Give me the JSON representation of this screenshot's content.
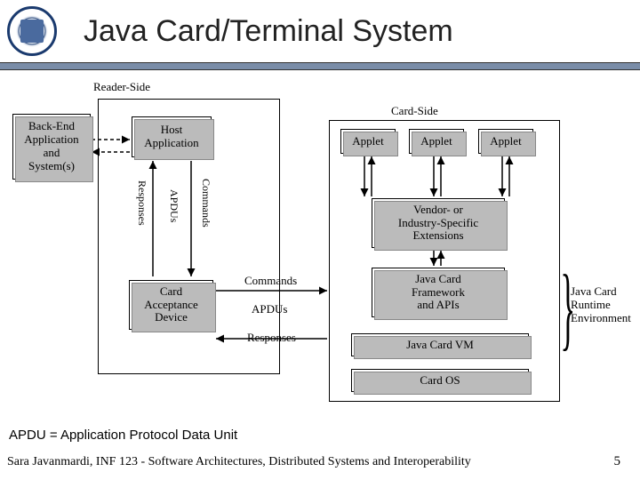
{
  "header": {
    "title": "Java Card/Terminal System"
  },
  "diagram": {
    "reader_side_label": "Reader-Side",
    "card_side_label": "Card-Side",
    "backend": "Back-End\nApplication\nand\nSystem(s)",
    "host_app": "Host\nApplication",
    "cad": "Card\nAcceptance\nDevice",
    "applet1": "Applet",
    "applet2": "Applet",
    "applet3": "Applet",
    "vendor_ext": "Vendor- or\nIndustry-Specific\nExtensions",
    "jc_framework": "Java Card\nFramework\nand APIs",
    "jc_vm": "Java Card VM",
    "card_os": "Card OS",
    "responses_v": "Responses",
    "apdus_v": "APDUs",
    "commands_v": "Commands",
    "commands_h": "Commands",
    "apdus_h": "APDUs",
    "responses_h": "Responses",
    "jcre_label": "Java Card\nRuntime\nEnvironment"
  },
  "note": "APDU = Application Protocol Data Unit",
  "footer": "Sara Javanmardi, INF 123 - Software Architectures, Distributed Systems and Interoperability",
  "page_number": "5"
}
